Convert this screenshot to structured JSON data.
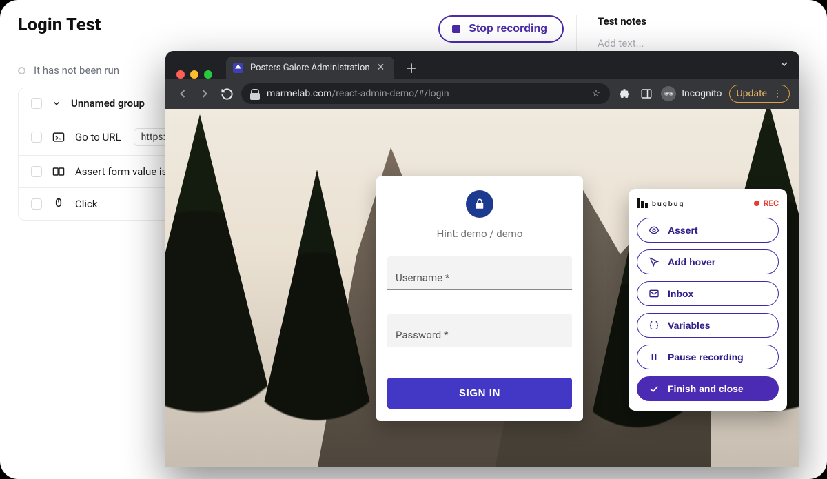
{
  "runner": {
    "title": "Login Test",
    "stop_button": "Stop recording",
    "status_text": "It has not been run",
    "group": {
      "name": "Unnamed group",
      "steps": [
        {
          "kind": "goto",
          "label": "Go to URL",
          "url": "https://m"
        },
        {
          "kind": "assert",
          "label": "Assert form value is"
        },
        {
          "kind": "click",
          "label": "Click"
        }
      ]
    }
  },
  "notes": {
    "heading": "Test notes",
    "placeholder": "Add text..."
  },
  "browser": {
    "tab_title": "Posters Galore Administration",
    "url_host": "marmelab.com",
    "url_path": "/react-admin-demo/#/login",
    "incognito_label": "Incognito",
    "update_label": "Update"
  },
  "login": {
    "hint": "Hint: demo / demo",
    "username_label": "Username *",
    "password_label": "Password *",
    "submit": "SIGN IN"
  },
  "recorder": {
    "brand": "bugbug",
    "status": "REC",
    "buttons": {
      "assert": "Assert",
      "hover": "Add hover",
      "inbox": "Inbox",
      "vars": "Variables",
      "pause": "Pause recording",
      "finish": "Finish and close"
    }
  },
  "colors": {
    "accent": "#4b2ba6",
    "accent_fill": "#4b2bb3",
    "rec_red": "#e63b2e",
    "update_amber": "#e3a23b"
  }
}
